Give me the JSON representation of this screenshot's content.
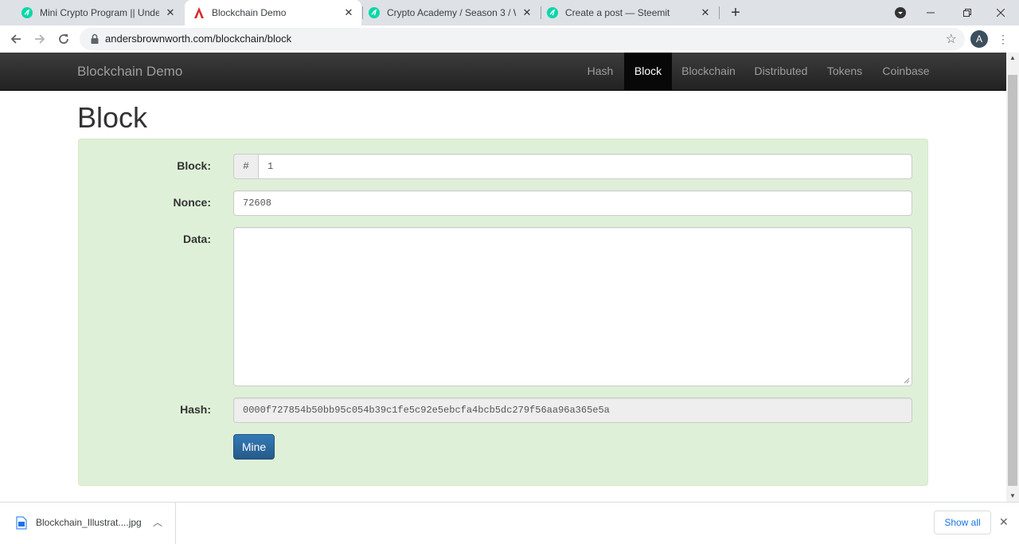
{
  "browser": {
    "tabs": [
      {
        "title": "Mini Crypto Program || Understa",
        "favicon": "steemit-icon",
        "active": false
      },
      {
        "title": "Blockchain Demo",
        "favicon": "anders-logo-icon",
        "active": true
      },
      {
        "title": "Crypto Academy / Season 3 / We",
        "favicon": "steemit-icon",
        "active": false
      },
      {
        "title": "Create a post — Steemit",
        "favicon": "steemit-icon",
        "active": false
      }
    ],
    "url": "andersbrownworth.com/blockchain/block",
    "profile_initial": "A"
  },
  "site": {
    "brand": "Blockchain Demo",
    "nav": [
      {
        "label": "Hash",
        "active": false
      },
      {
        "label": "Block",
        "active": true
      },
      {
        "label": "Blockchain",
        "active": false
      },
      {
        "label": "Distributed",
        "active": false
      },
      {
        "label": "Tokens",
        "active": false
      },
      {
        "label": "Coinbase",
        "active": false
      }
    ]
  },
  "page": {
    "title": "Block",
    "form": {
      "block_label": "Block:",
      "block_addon": "#",
      "block_value": "1",
      "nonce_label": "Nonce:",
      "nonce_value": "72608",
      "data_label": "Data:",
      "data_value": "",
      "hash_label": "Hash:",
      "hash_value": "0000f727854b50bb95c054b39c1fe5c92e5ebcfa4bcb5dc279f56aa96a365e5a",
      "mine_label": "Mine"
    },
    "colors": {
      "valid_background": "#dff0d8",
      "navbar": "#222222",
      "button": "#337ab7"
    }
  },
  "downloads": {
    "file_name": "Blockchain_Illustrat....jpg",
    "show_all_label": "Show all"
  }
}
